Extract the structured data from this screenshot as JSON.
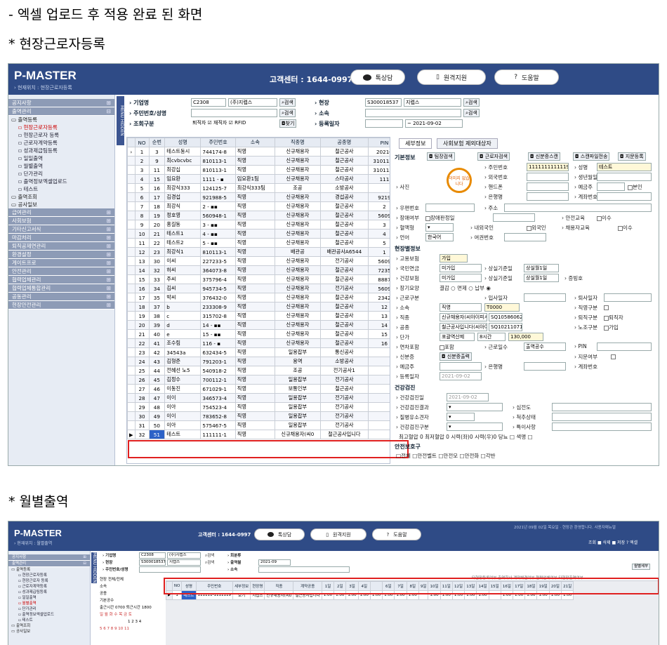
{
  "captions": {
    "c1": "- 엑셀 업로드 후 적용 완료 된 화면",
    "c2": "* 현장근로자등록",
    "c3": "* 월별출역"
  },
  "colors": {
    "header": "#2f4b86",
    "highlight_box": "#e02020",
    "selected_cell": "#2d62c7"
  },
  "shot1": {
    "brand": "P-MASTER",
    "location": "› 현재위치 : 현장근로자등록",
    "call_center": "고객센터 : 1644-0997",
    "btn_talk": "톡상담",
    "btn_remote": "원격지원",
    "btn_help": "도움말",
    "menu_hidden": "MENU HIDDEN",
    "sidebar": {
      "b1": "공지사항",
      "b2": "출역관리",
      "f1": "출역등록",
      "s1": "현장근로자등록",
      "s2": "현장근로자 등록",
      "s3": "근로자계약등록",
      "s4": "성과제급팀등록",
      "s5": "일일출역",
      "s6": "월별출역",
      "s7": "단가관리",
      "s8": "출역정보엑셀업로드",
      "s9": "테스트",
      "f2": "출역조회",
      "f3": "공사일보",
      "b3": "급여관리",
      "b4": "사회보험",
      "b5": "기타신고서식",
      "b6": "마감처리",
      "b7": "퇴직공제연관리",
      "b8": "환경설정",
      "b9": "게이트프로",
      "b10": "안전관리",
      "b11": "협력업체관리",
      "b12": "협력업체통합관리",
      "b13": "공동관리",
      "b14": "현장안전관리"
    },
    "search": {
      "l_company": "› 기업명",
      "company_code": "C2308",
      "company_name": "(주)지렙스",
      "search": "검색",
      "l_site": "› 현장",
      "site_code": "S300018537",
      "site_name": "지렙스",
      "l_rrn": "› 주민번호/성명",
      "l_dept": "› 소속",
      "l_cond": "› 조회구분",
      "cond": "퇴직자 ☑  재직자 ☑  RFID",
      "find": "찾기",
      "l_regdate": "› 등록일자",
      "date_to": "~  2021-09-02"
    },
    "grid": {
      "headers": [
        "NO",
        "순번",
        "성명",
        "주민번호",
        "소속",
        "직종명",
        "공종명",
        "PIN"
      ],
      "rows": [
        [
          "1",
          "3",
          "테스트동시",
          "744174-8",
          "직영",
          "신규채용자",
          "철근공사",
          "20210"
        ],
        [
          "2",
          "9",
          "최cvbcvbc",
          "810113-1",
          "직영",
          "신규채용자",
          "철근공사",
          "3101131"
        ],
        [
          "3",
          "11",
          "최강십",
          "810113-1",
          "직영",
          "신규채용자",
          "철근공사",
          "3101131"
        ],
        [
          "4",
          "15",
          "임요환",
          "1111 - ▪",
          "임요환1팀",
          "신규채용자",
          "스타공사",
          "111"
        ],
        [
          "5",
          "16",
          "최강식333",
          "124125-7",
          "최강식333팀",
          "조공",
          "소방공사",
          ""
        ],
        [
          "6",
          "17",
          "김경섭",
          "921988-5",
          "직영",
          "신규채용자",
          "경섭공사",
          "9219"
        ],
        [
          "7",
          "18",
          "최강식",
          "2 - ▪▪",
          "직영",
          "신규채용자",
          "철근공사",
          "2"
        ],
        [
          "8",
          "19",
          "정호영",
          "560948-1",
          "직영",
          "신규채용자",
          "철근공사",
          "5609"
        ],
        [
          "9",
          "20",
          "홍길동",
          "3 - ▪▪",
          "직영",
          "신규채용자",
          "철근공사",
          "3"
        ],
        [
          "10",
          "21",
          "테스트1",
          "4 - ▪▪",
          "직영",
          "신규채용자",
          "철근공사",
          "4"
        ],
        [
          "11",
          "22",
          "테스트2",
          "5 - ▪▪",
          "직영",
          "신규채용자",
          "철근공사",
          "5"
        ],
        [
          "12",
          "23",
          "최강식1",
          "810113-1",
          "직영",
          "배관공",
          "배관공사A6544",
          "1"
        ],
        [
          "13",
          "30",
          "이씨",
          "227233-5",
          "직영",
          "신규채용자",
          "전기공사",
          "5609"
        ],
        [
          "14",
          "32",
          "허씨",
          "364073-8",
          "직영",
          "신규채용자",
          "철근공사",
          "7235"
        ],
        [
          "15",
          "33",
          "주씨",
          "375796-4",
          "직영",
          "신규채용자",
          "철근공사",
          "8887"
        ],
        [
          "16",
          "34",
          "김씨",
          "945734-5",
          "직영",
          "신규채용자",
          "전기공사",
          "5609"
        ],
        [
          "17",
          "35",
          "박씨",
          "376432-0",
          "직영",
          "신규채용자",
          "철근공사",
          "2342"
        ],
        [
          "18",
          "37",
          "b",
          "233308-9",
          "직영",
          "신규채용자",
          "철근공사",
          "12"
        ],
        [
          "19",
          "38",
          "c",
          "315702-8",
          "직영",
          "신규채용자",
          "철근공사",
          "13"
        ],
        [
          "20",
          "39",
          "d",
          "14 - ▪▪",
          "직영",
          "신규채용자",
          "철근공사",
          "14"
        ],
        [
          "21",
          "40",
          "e",
          "15 - ▪▪",
          "직영",
          "신규채용자",
          "철근공사",
          "15"
        ],
        [
          "22",
          "41",
          "조수림",
          "116 - ▪",
          "직영",
          "신규채용자",
          "철근공사",
          "16"
        ],
        [
          "23",
          "42",
          "34543a",
          "632434-5",
          "직영",
          "일용잡부",
          "통신공사",
          ""
        ],
        [
          "24",
          "43",
          "김형준",
          "791203-1",
          "직영",
          "용역",
          "소방공사",
          ""
        ],
        [
          "25",
          "44",
          "전혜선 노5",
          "540918-2",
          "직영",
          "조공",
          "전기공사1",
          ""
        ],
        [
          "26",
          "45",
          "김정수",
          "700112-1",
          "직영",
          "일용잡부",
          "전기공사",
          ""
        ],
        [
          "27",
          "46",
          "이동진",
          "671029-1",
          "직영",
          "보통인부",
          "철근공사",
          ""
        ],
        [
          "28",
          "47",
          "이이",
          "346573-4",
          "직영",
          "일용잡부",
          "전기공사",
          ""
        ],
        [
          "29",
          "48",
          "이아",
          "754523-4",
          "직영",
          "일용잡부",
          "전기공사",
          ""
        ],
        [
          "30",
          "49",
          "이이",
          "783652-8",
          "직영",
          "일용잡부",
          "전기공사",
          ""
        ],
        [
          "31",
          "50",
          "이아",
          "575467-5",
          "직영",
          "일용잡부",
          "전기공사",
          ""
        ]
      ],
      "sel": [
        "32",
        "51",
        "테스트",
        "111111-1",
        "직영",
        "신규채용자(씨0",
        "철근공사입니다",
        ""
      ]
    },
    "detail": {
      "tab1": "세부정보",
      "tab2": "사회보험 제외대상자",
      "l_basic": "기본정보",
      "b_team": "팀장검색",
      "b_worker": "근로자검색",
      "b_idcard": "신분증스캔",
      "b_scan": "스캔파일전송",
      "b_fp": "지문등록",
      "l_photo": "› 사진",
      "no_image": "이미지 없습니다",
      "l_rrn": "› 주민번호",
      "rrn": "1111111111119",
      "l_name": "› 성명",
      "name": "테스트",
      "l_foreign": "› 외국번호",
      "l_birth": "› 생년월일",
      "l_phone": "› 핸드폰",
      "l_holder": "› 예금주",
      "self": "본인",
      "l_bank": "› 은행명",
      "l_acct": "› 계좌번호",
      "l_zip": "› 우편번호",
      "l_addr": "› 주소",
      "l_disab": "› 장애여부",
      "disab_val": "장애판정일",
      "l_safety": "› 안전교육",
      "completed": "이수",
      "l_blood": "› 혈액형",
      "l_native": "› 내외국인",
      "foreigner": "외국인",
      "l_hireedu": "› 채용자교육",
      "l_lang": "› 언어",
      "lang": "한국어",
      "l_passport": "› 여권번호",
      "l_ins": "현장별정보",
      "l_emp": "› 고용보험",
      "emp": "가입",
      "l_pension": "› 국민연금",
      "pension": "미가입",
      "l_loss": "› 상실기준일",
      "loss": "상실월1일",
      "l_health": "› 건강보험",
      "health": "미가입",
      "l_cert": "› 증빙호",
      "l_care": "› 장기요양",
      "care": "결감 ○  면제 ○  납부 ◉",
      "l_type": "› 근로구분",
      "l_join": "› 입사일자",
      "l_retire": "› 퇴사일자",
      "l_dept": "› 소속",
      "dept": "직영",
      "dept_code": "T0000",
      "l_jobtype": "› 직영구분",
      "l_job": "› 직종",
      "job": "신규채용자(씨아이피시",
      "job_code": "SQ10586062",
      "l_retiretype": "› 퇴직구분",
      "retire_type": "퇴직자",
      "l_work": "› 공종",
      "work": "철근공사입니다(씨아이",
      "work_code": "SQ10211071",
      "l_union": "› 노조구분",
      "join_opt": "가입",
      "l_price": "› 단가",
      "price_type": "포괄역산제",
      "hours": "8시간",
      "price": "130,000",
      "l_bonus": "› 연차포함",
      "bonus": "포함",
      "l_workdays": "› 근로일수",
      "workdays": "출역공수",
      "l_pin": "› PIN",
      "l_idc": "› 신분증",
      "idc": "신분증출력",
      "l_fingerprint": "› 지문여부",
      "l_holder2": "› 예금주",
      "l_bank2": "› 은행명",
      "l_acct2": "› 계좌번호",
      "l_regdate": "› 등록일자",
      "regdate": "2021-09-02",
      "l_check": "건강검진",
      "l_ckdate": "› 건강검진일",
      "ckdate": "2021-09-02",
      "l_ckres": "› 건강검진결과",
      "l_heart": "› 심전도",
      "l_disease": "› 질병유소견자",
      "l_spine": "› 척추상태",
      "l_cktype": "› 건강검진구분",
      "l_special": "› 특이사항",
      "bp": "최고혈압 0      최저혈압 0      시력(좌)0      시력(우)0      당뇨 □  색맹 □",
      "l_gear": "안전보호구",
      "gear": "□전체  □안전벨트  □안전모  □안전화  □각반"
    }
  },
  "shot2": {
    "brand": "P-MASTER",
    "location": "› 현재위치 : 월별출역",
    "call_center": "고객센터 : 1644-0997",
    "btn_talk": "톡상담",
    "btn_remote": "원격지원",
    "btn_help": "도움말",
    "topright": "2021년 09월 02일 목요일 · 현장관 환영합니다.  사용자매뉴얼",
    "tb": "조회  ■ 삭제  ■ 저장  ? 엑셀",
    "sidebar": {
      "b1": "공지사항",
      "b2": "출역관리",
      "f1": "출역등록",
      "s1": "현장근로자등록",
      "s2": "현장근로자 등록",
      "s3": "근로자계약등록",
      "s4": "성과제급팀등록",
      "s5": "일일출역",
      "s6": "월별출역",
      "s7": "단가관리",
      "s8": "출역정보엑셀업로드",
      "s9": "테스트",
      "f2": "출역조회",
      "f3": "공사일보"
    },
    "search": {
      "l_company": "› 기업명",
      "company_code": "C2308",
      "company_name": "(주)지렙스",
      "search": "검색",
      "l_site": "› 현장",
      "site_code": "S300018537",
      "site_name": "지렙스",
      "l_rrn": "› 주민번호/성명",
      "l_period": "› 출역월",
      "period": "2021-09",
      "l_dept": "› 소속",
      "l_ym": "› 회분류",
      "detail": "월별세부"
    },
    "left": {
      "site": "현장 전체/전체",
      "dept": "소속",
      "job": "공종",
      "base": "기본공수",
      "time": "출근시간 0700 퇴근시간 1800",
      "days": "일 월 화 수 목 금 토",
      "cal1": "1 2 3 4",
      "cal2": "5 6 7 8 9 10 11"
    },
    "legend": "타현장등록여부    출역회사    계약체결여부    협력업체여부    타현장출역여부",
    "headers": [
      "NO",
      "성명",
      "주민번호",
      "세부정보",
      "현장명",
      "직종",
      "계약공종",
      "1일",
      "2일",
      "3일",
      "4일",
      "",
      "6일",
      "7일",
      "8일",
      "9일",
      "10일",
      "11일",
      "12일",
      "13일",
      "14일",
      "15일",
      "16일",
      "17일",
      "18일",
      "19일",
      "20일",
      "21일"
    ],
    "row": [
      "1",
      "테스트",
      "111111-1111119",
      "보기",
      "지렙스",
      "신규채용자(씨0",
      "철근공사입니다",
      "1.00",
      "1.00",
      "1.00",
      "1.00",
      "1.00",
      "1.00",
      "1.00",
      "1.00",
      "",
      "1.00",
      "1.00",
      "1.00",
      "1.00",
      "1.00",
      "",
      "1.00",
      "1.00",
      "1.00",
      "1.00",
      "1.00",
      "1.00"
    ]
  }
}
